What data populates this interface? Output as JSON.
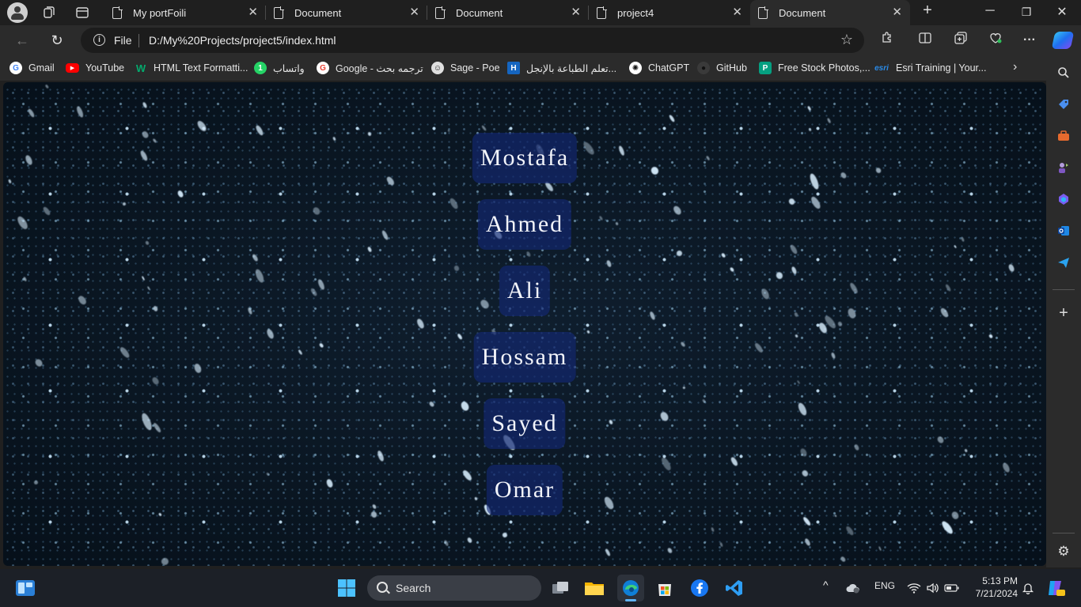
{
  "browser": {
    "tabs": [
      {
        "label": "My portFoili",
        "active": false
      },
      {
        "label": "Document",
        "active": false
      },
      {
        "label": "Document",
        "active": false
      },
      {
        "label": "project4",
        "active": false
      },
      {
        "label": "Document",
        "active": true
      }
    ],
    "new_tab_label": "+",
    "address": {
      "scheme_label": "File",
      "url": "D:/My%20Projects/project5/index.html"
    },
    "bookmarks": [
      {
        "label": "Gmail",
        "icon": "google-icon",
        "color": "#ffffff"
      },
      {
        "label": "YouTube",
        "icon": "youtube-icon",
        "color": "#ff0000"
      },
      {
        "label": "HTML Text Formatti...",
        "icon": "w3-icon",
        "color": "#04aa6d"
      },
      {
        "label": "واتساب",
        "icon": "whatsapp-icon",
        "color": "#25d366"
      },
      {
        "label": "Google - ترجمه بحث",
        "icon": "google-icon",
        "color": "#ffffff"
      },
      {
        "label": "Sage - Poe",
        "icon": "poe-icon",
        "color": "#e0e0e0"
      },
      {
        "label": "تعلم الطباعة بالإنجل...",
        "icon": "h-icon",
        "color": "#1565c0"
      },
      {
        "label": "ChatGPT",
        "icon": "chatgpt-icon",
        "color": "#ffffff"
      },
      {
        "label": "GitHub",
        "icon": "github-icon",
        "color": "#3a3a3a"
      },
      {
        "label": "Free Stock Photos,...",
        "icon": "pexels-icon",
        "color": "#05a081"
      },
      {
        "label": "Esri Training | Your...",
        "icon": "esri-icon",
        "color": "#2a8be8"
      }
    ]
  },
  "page": {
    "names": [
      "Mostafa",
      "Ahmed",
      "Ali",
      "Hossam",
      "Sayed",
      "Omar"
    ]
  },
  "taskbar": {
    "search_label": "Search",
    "language": "ENG",
    "time": "5:13 PM",
    "date": "7/21/2024"
  }
}
